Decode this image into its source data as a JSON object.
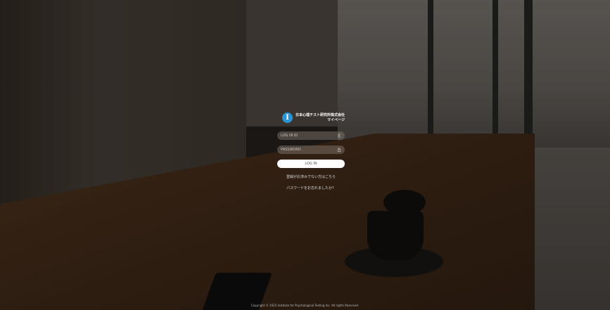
{
  "brand": {
    "logo_glyph": "I",
    "name_line1": "日本心理テスト研究所株式会社",
    "name_line2": "マイページ",
    "accent_color": "#2b93d1"
  },
  "form": {
    "login_id_placeholder": "LOG IN ID",
    "login_id_icon": "user-icon",
    "password_placeholder": "PASSWORD",
    "password_icon": "lock-icon",
    "submit_label": "LOG IN"
  },
  "links": {
    "register": "登録がお済みでない方はこちら",
    "forgot_password": "パスワードをお忘れましたか？"
  },
  "footer": {
    "copyright": "Copyright © 2023 Institute for Psychological Testing Inc. All rights Reserved."
  }
}
